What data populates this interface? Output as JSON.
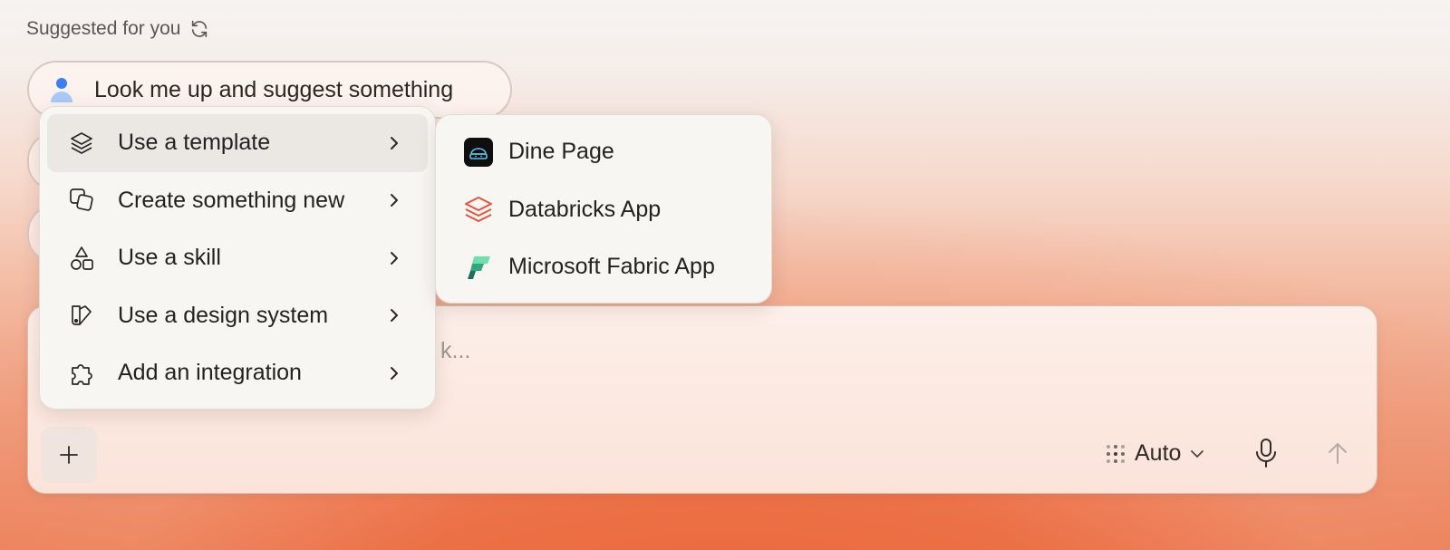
{
  "suggestions": {
    "heading": "Suggested for you",
    "refresh_icon": "refresh-icon",
    "items": [
      {
        "label": "Look me up and suggest something",
        "icon": "user-avatar-icon"
      }
    ]
  },
  "composer": {
    "placeholder_visible": "k...",
    "model": "Auto",
    "icons": [
      "plus-icon",
      "model-dots-icon",
      "chevron-down-icon",
      "microphone-icon",
      "arrow-up-icon"
    ]
  },
  "menu": {
    "items": [
      {
        "label": "Use a template",
        "icon": "layers-icon",
        "active": true
      },
      {
        "label": "Create something new",
        "icon": "copy-squares-icon"
      },
      {
        "label": "Use a skill",
        "icon": "shapes-icon"
      },
      {
        "label": "Use a design system",
        "icon": "palette-book-icon"
      },
      {
        "label": "Add an integration",
        "icon": "puzzle-icon"
      }
    ]
  },
  "submenu": {
    "items": [
      {
        "label": "Dine Page",
        "icon": "dine-page-logo-icon"
      },
      {
        "label": "Databricks App",
        "icon": "databricks-logo-icon"
      },
      {
        "label": "Microsoft Fabric App",
        "icon": "microsoft-fabric-logo-icon"
      }
    ]
  },
  "colors": {
    "accent_orange": "#ec6b3f",
    "menu_bg": "#f8f6f3",
    "menu_active": "#ebe8e3",
    "databricks_red": "#e4553b",
    "fabric_green": "#3fb98a"
  }
}
